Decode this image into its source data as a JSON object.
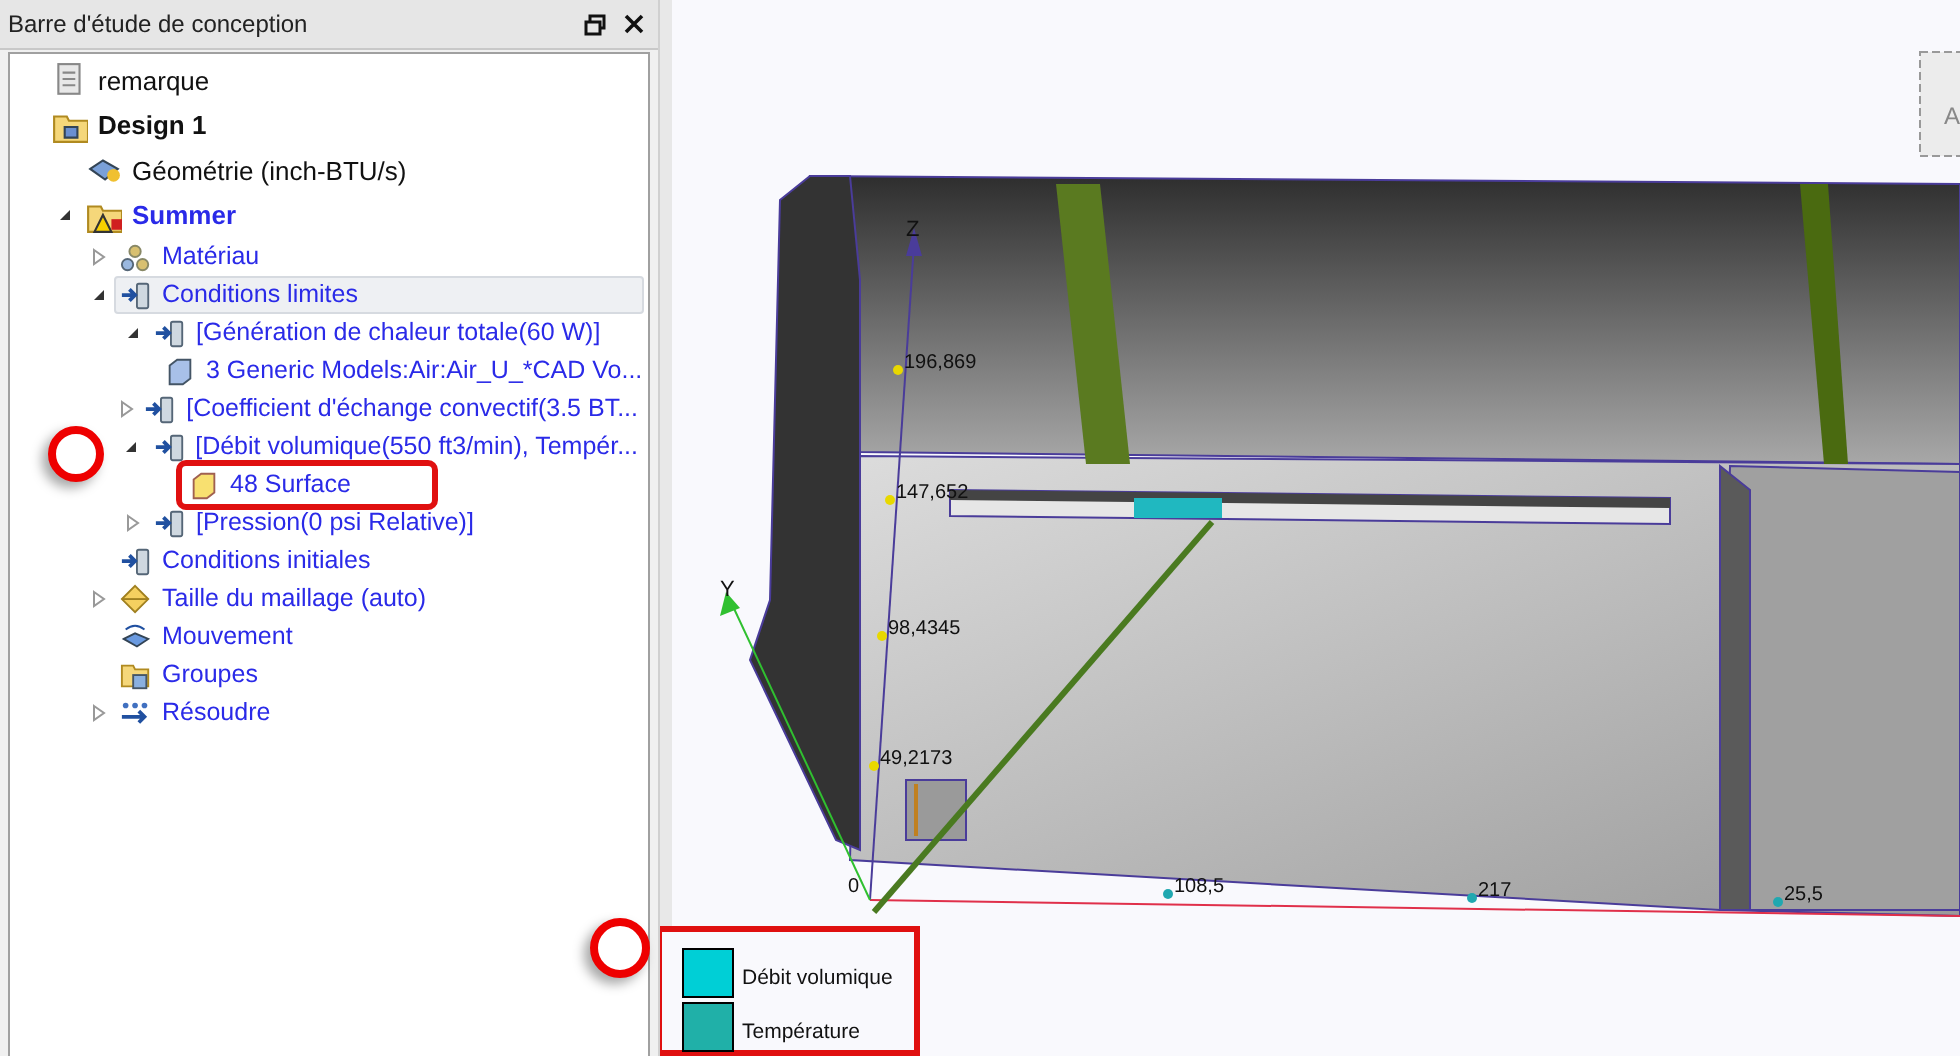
{
  "panel": {
    "title": "Barre d'étude de conception"
  },
  "tree": [
    {
      "label": "remarque",
      "kind": "note"
    },
    {
      "label": "Design 1",
      "kind": "design",
      "children": [
        {
          "label": "Géométrie (inch-BTU/s)",
          "kind": "geometry"
        },
        {
          "label": "Summer",
          "kind": "scenario",
          "expanded": true,
          "children": [
            {
              "label": "Matériau",
              "kind": "material",
              "expanded": false
            },
            {
              "label": "Conditions limites",
              "kind": "boundary",
              "expanded": true,
              "selected": true,
              "children": [
                {
                  "label": "[Génération de chaleur totale(60 W)]",
                  "kind": "load",
                  "expanded": true,
                  "children": [
                    {
                      "label": "3 Generic Models:Air:Air_U_*CAD Vo...",
                      "kind": "part"
                    }
                  ]
                },
                {
                  "label": "[Coefficient d'échange convectif(3.5 BT...",
                  "kind": "load",
                  "expanded": false
                },
                {
                  "label": "[Débit volumique(550 ft3/min), Tempér...",
                  "kind": "load",
                  "expanded": true,
                  "children": [
                    {
                      "label": "48 Surface",
                      "kind": "surface",
                      "highlighted": true
                    }
                  ]
                },
                {
                  "label": "[Pression(0 psi Relative)]",
                  "kind": "load",
                  "expanded": false
                }
              ]
            },
            {
              "label": "Conditions initiales",
              "kind": "initial"
            },
            {
              "label": "Taille du maillage (auto)",
              "kind": "mesh",
              "expanded": false
            },
            {
              "label": "Mouvement",
              "kind": "motion"
            },
            {
              "label": "Groupes",
              "kind": "groups"
            },
            {
              "label": "Résoudre",
              "kind": "solve",
              "expanded": false
            }
          ]
        }
      ]
    }
  ],
  "viewport": {
    "axes": {
      "z": "Z",
      "y": "Y"
    },
    "ticks": [
      "196,869",
      "147,652",
      "98,4345",
      "49,2173",
      "0",
      "108,5",
      "217",
      "25,5"
    ],
    "view_cube": {
      "label": "A"
    },
    "legend": {
      "highlighted": true,
      "items": [
        {
          "label": "Débit volumique",
          "color": "#00cfd6"
        },
        {
          "label": "Température",
          "color": "#20b0a8"
        }
      ]
    }
  }
}
